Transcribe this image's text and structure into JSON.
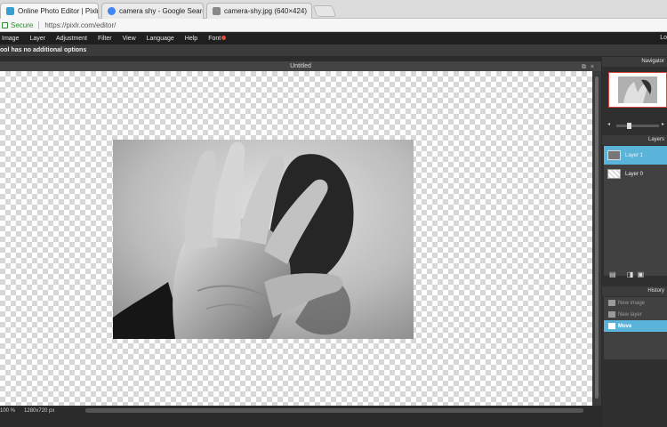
{
  "browser": {
    "tabs": [
      {
        "title": "Online Photo Editor | Pixlr Edit",
        "active": true
      },
      {
        "title": "camera shy - Google Search",
        "active": false
      },
      {
        "title": "camera-shy.jpg (640×424)",
        "active": false
      }
    ],
    "tab_close": "×",
    "secure_label": "Secure",
    "url": "https://pixlr.com/editor/"
  },
  "menu": {
    "items": [
      "Image",
      "Layer",
      "Adjustment",
      "Filter",
      "View",
      "Language",
      "Help",
      "Font"
    ],
    "right_cut": "Lo"
  },
  "tool_options": {
    "text": "ool has no additional options"
  },
  "document": {
    "title": "Untitled",
    "zoom": "100 %",
    "size": "1280x720 px"
  },
  "navigator": {
    "title": "Navigator"
  },
  "layers": {
    "title": "Layers",
    "items": [
      {
        "label": "Layer 1",
        "active": true
      },
      {
        "label": "Layer 0",
        "active": false
      }
    ]
  },
  "history": {
    "title": "History",
    "items": [
      {
        "label": "New image",
        "active": false
      },
      {
        "label": "New layer",
        "active": false
      },
      {
        "label": "Move",
        "active": true
      }
    ]
  },
  "colors": {
    "accent": "#5ab4d9",
    "menu_bg": "#1f1f1f",
    "panel_bg": "#2f2f2f"
  }
}
